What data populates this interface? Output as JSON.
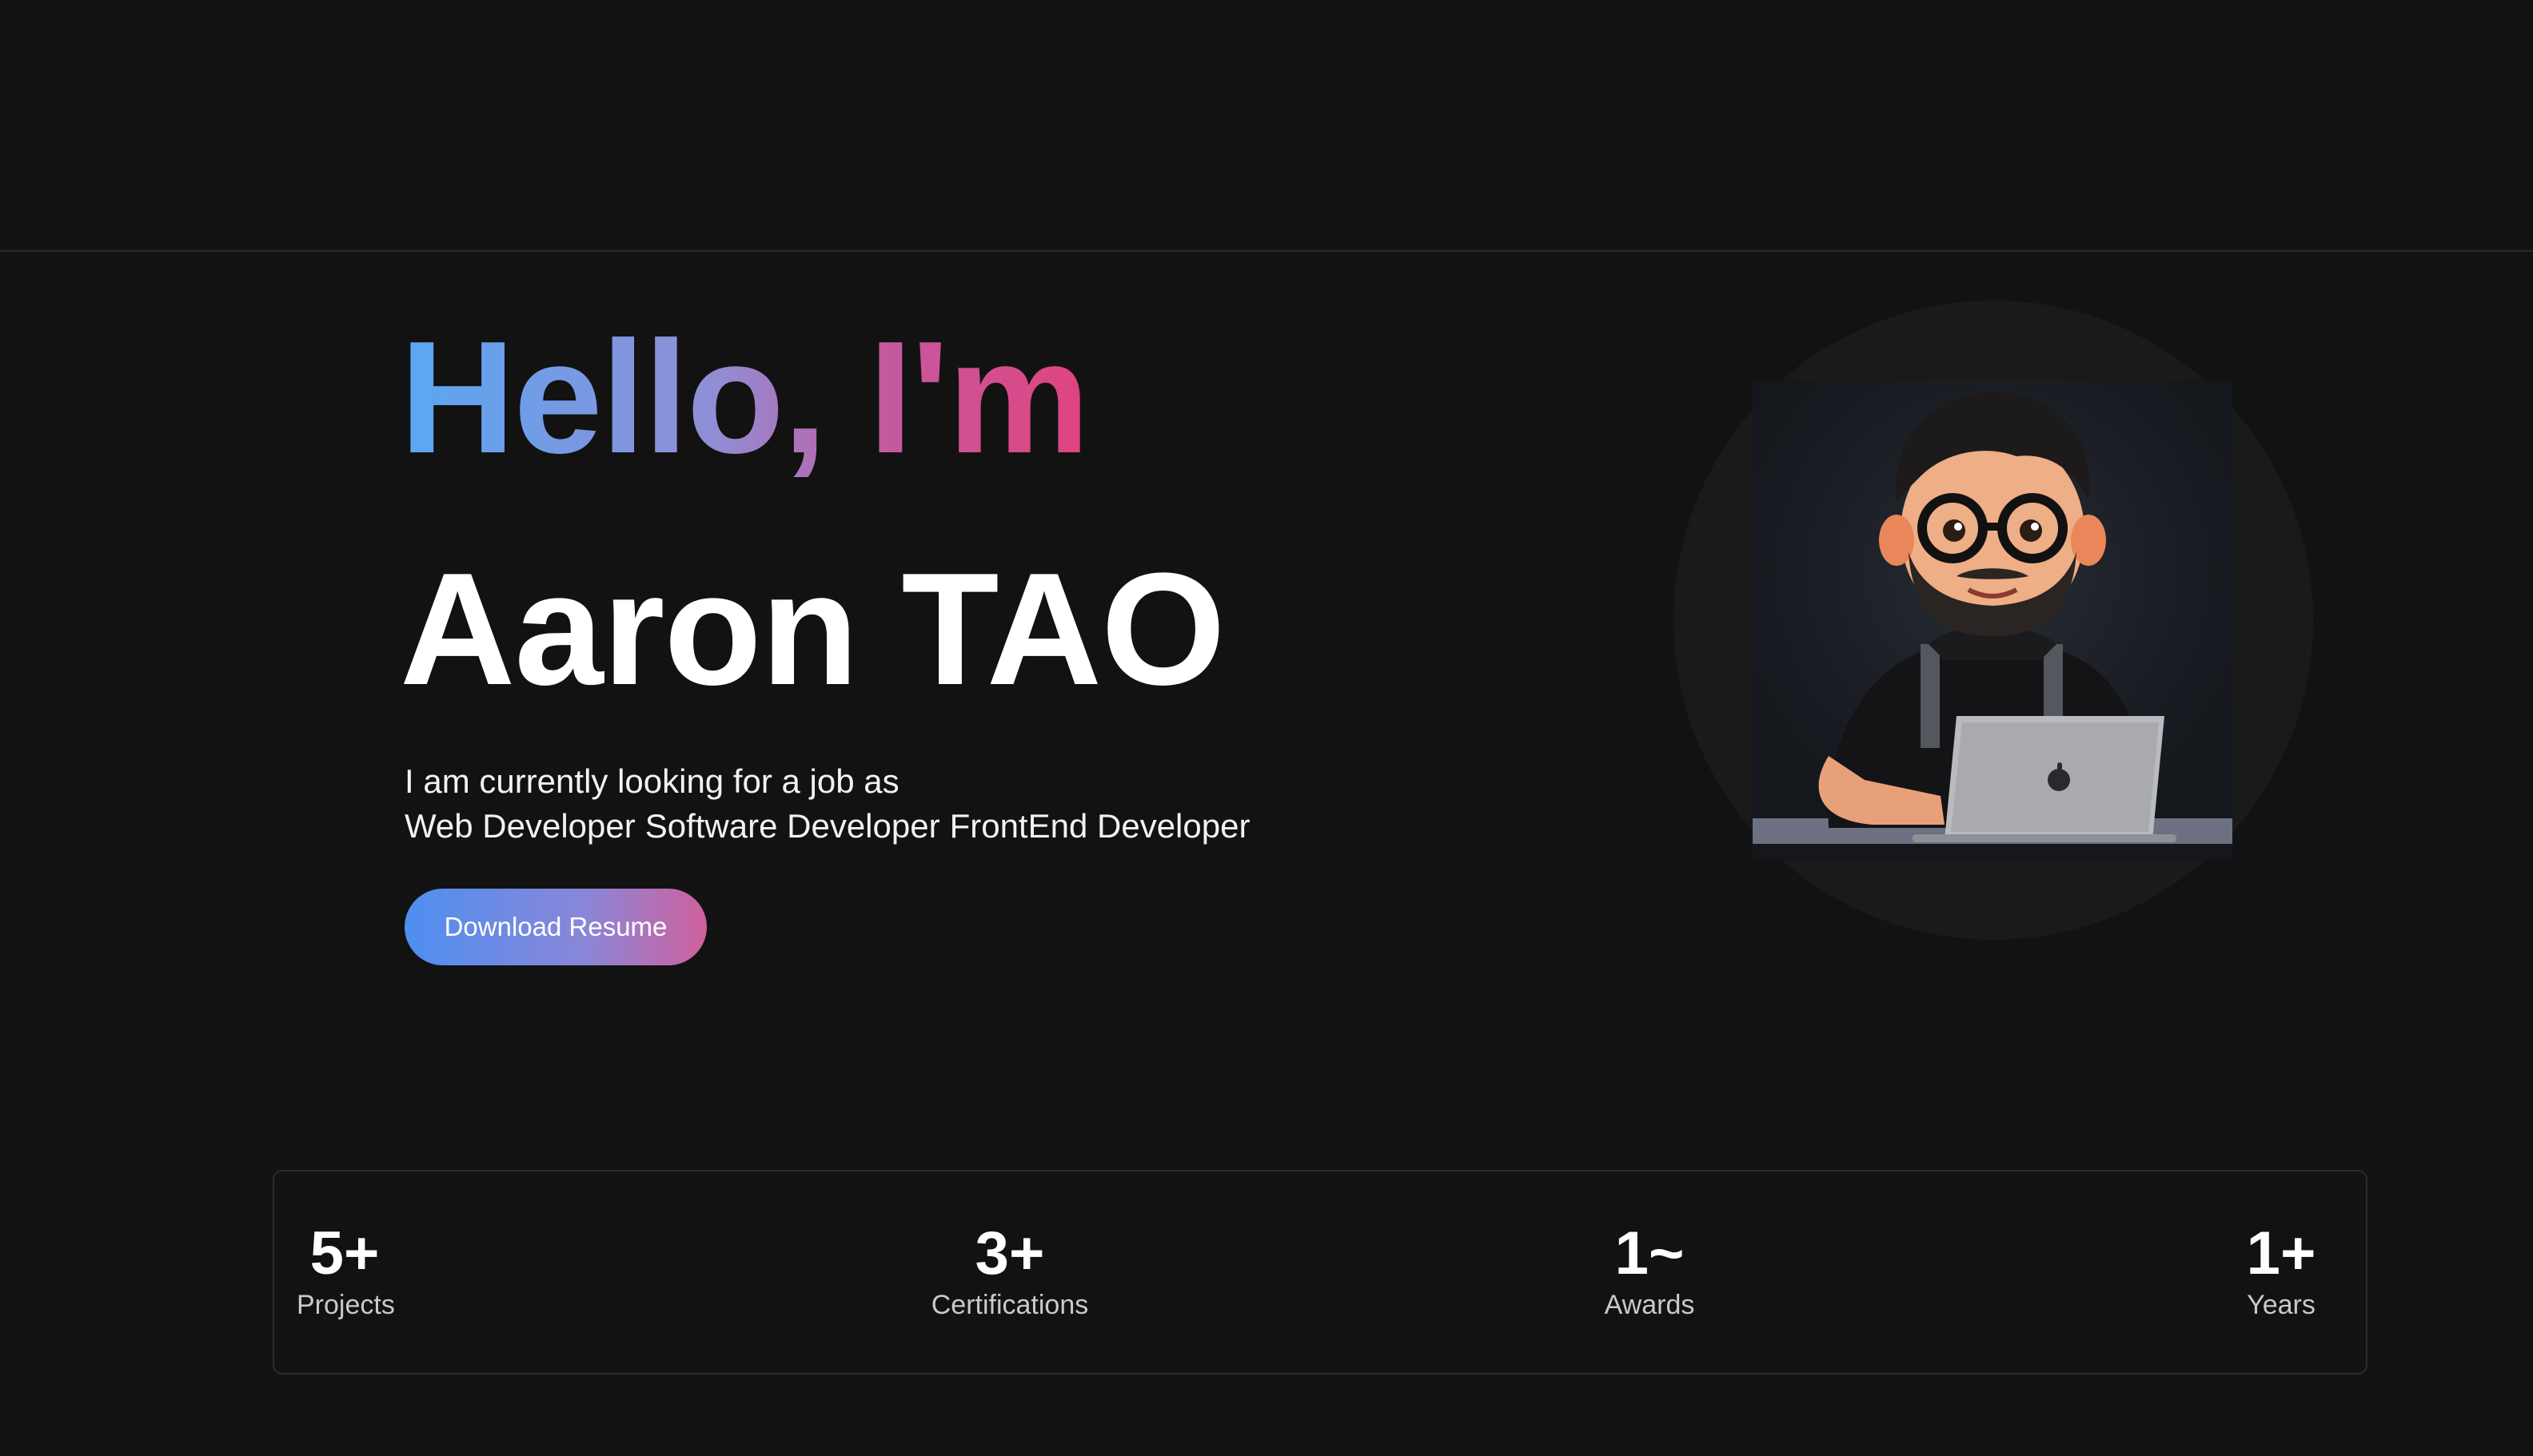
{
  "hero": {
    "greeting": "Hello, I'm",
    "name": "Aaron TAO",
    "intro": "I am currently looking for a job as",
    "roles": [
      "Web Developer",
      "Software Developer",
      "FrontEnd Developer"
    ],
    "download_label": "Download Resume"
  },
  "avatar": {
    "icon": "developer-avatar-illustration"
  },
  "stats": [
    {
      "value": "5+",
      "label": "Projects"
    },
    {
      "value": "3+",
      "label": "Certifications"
    },
    {
      "value": "1~",
      "label": "Awards"
    },
    {
      "value": "1+",
      "label": "Years"
    }
  ],
  "colors": {
    "background": "#121212",
    "gradient_start": "#5aa7f3",
    "gradient_end": "#e0437e"
  }
}
